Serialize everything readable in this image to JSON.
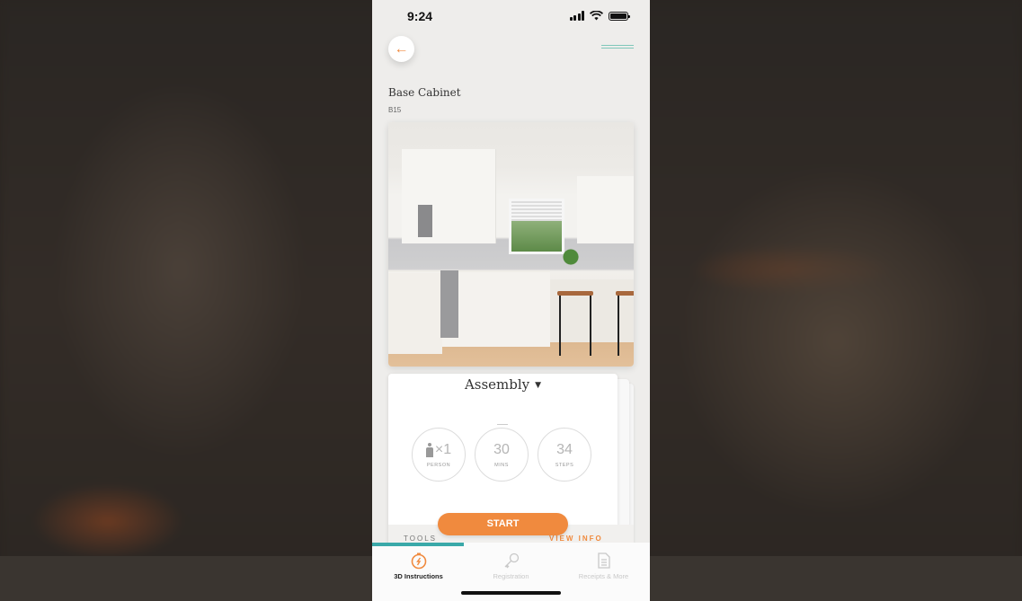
{
  "status_bar": {
    "time": "9:24"
  },
  "header": {
    "back_icon": "arrow-left-icon",
    "logo": "brand-logo"
  },
  "product": {
    "title": "Base Cabinet",
    "sku": "B15",
    "image": "white-kitchen-photo"
  },
  "assembly": {
    "title": "Assembly",
    "stats": [
      {
        "value": "×1",
        "label": "PERSON",
        "icon": "person-icon"
      },
      {
        "value": "30",
        "label": "MINS",
        "icon": "timer-icon"
      },
      {
        "value": "34",
        "label": "STEPS",
        "icon": ""
      }
    ],
    "start_label": "START",
    "tools_label": "TOOLS",
    "view_info_label": "VIEW INFO"
  },
  "tabs": [
    {
      "label": "3D Instructions",
      "icon": "compass-icon",
      "active": true
    },
    {
      "label": "Registration",
      "icon": "key-icon",
      "active": false
    },
    {
      "label": "Receipts & More",
      "icon": "document-icon",
      "active": false
    }
  ],
  "colors": {
    "accent": "#f08a3e",
    "teal": "#3aa9a9"
  }
}
